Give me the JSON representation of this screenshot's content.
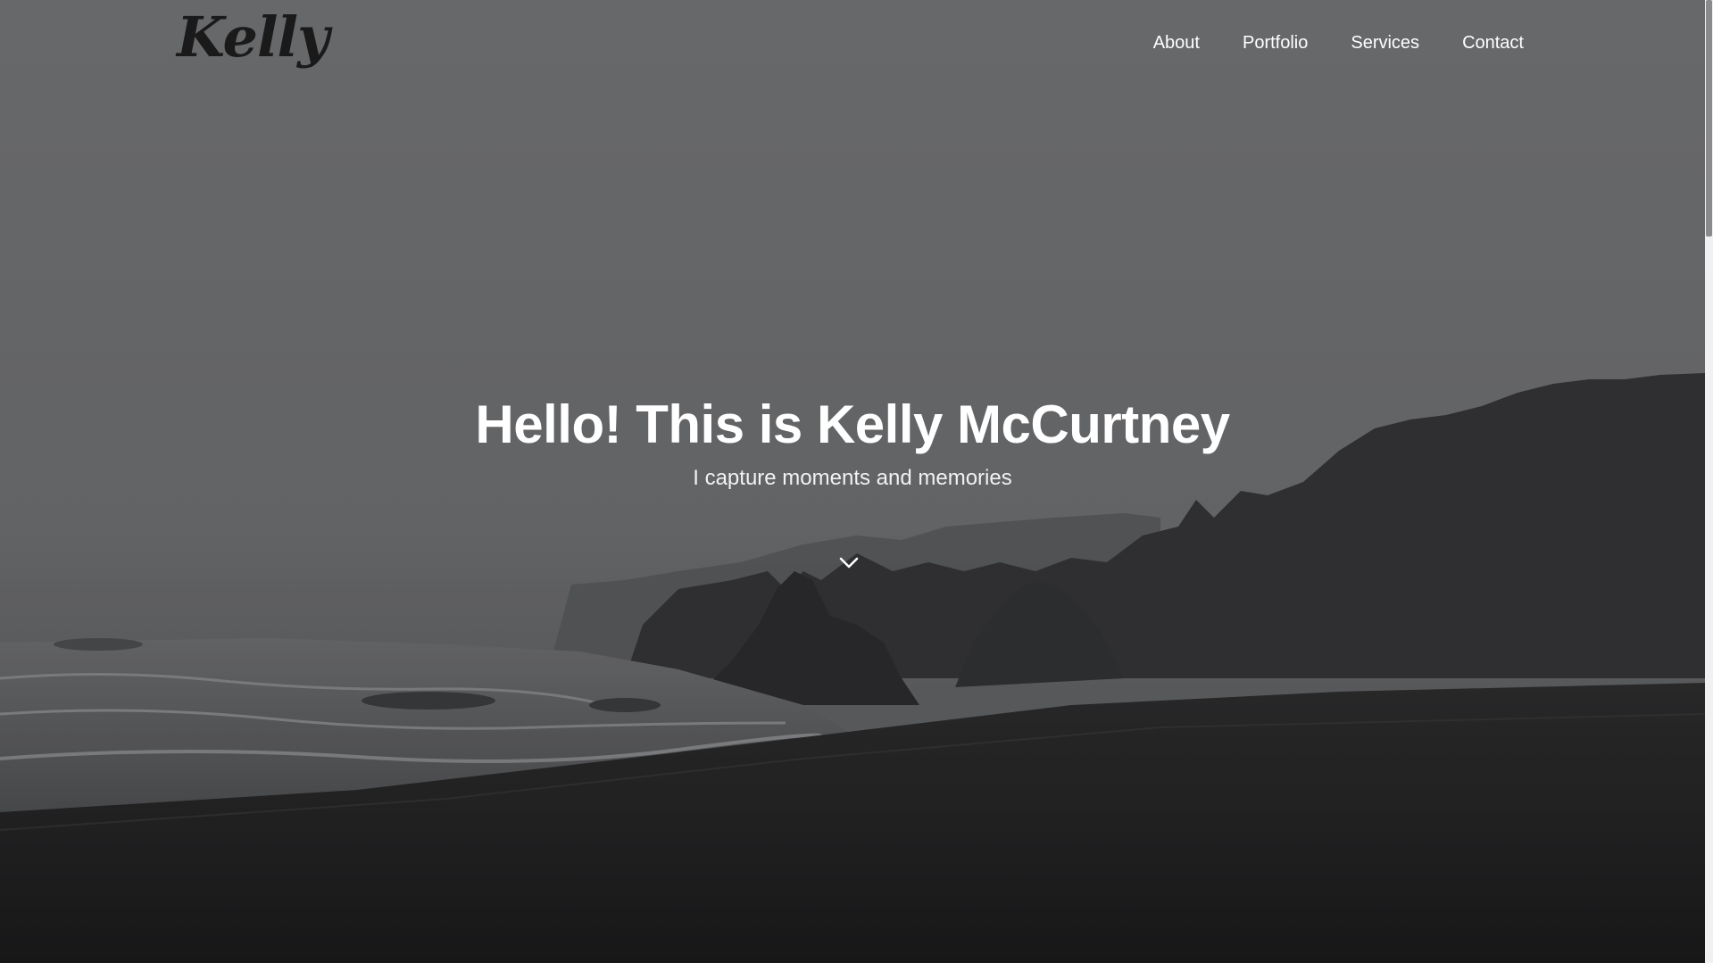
{
  "nav": {
    "logo": "Kelly",
    "links": [
      {
        "label": "About"
      },
      {
        "label": "Portfolio"
      },
      {
        "label": "Services"
      },
      {
        "label": "Contact"
      }
    ]
  },
  "hero": {
    "title": "Hello! This is Kelly McCurtney",
    "subtitle": "I capture moments and memories",
    "scroll_icon": "chevron-down-icon",
    "background": {
      "description_colors": {
        "sky": "#6e6f71",
        "cliffs": "#2e2f31",
        "beach": "#1e1e1f"
      }
    }
  },
  "colors": {
    "text_primary": "#ffffff",
    "logo": "#1a1a1a"
  },
  "scrollbar": {
    "track": "#f1f1f1",
    "thumb": "#8a8a8a"
  }
}
